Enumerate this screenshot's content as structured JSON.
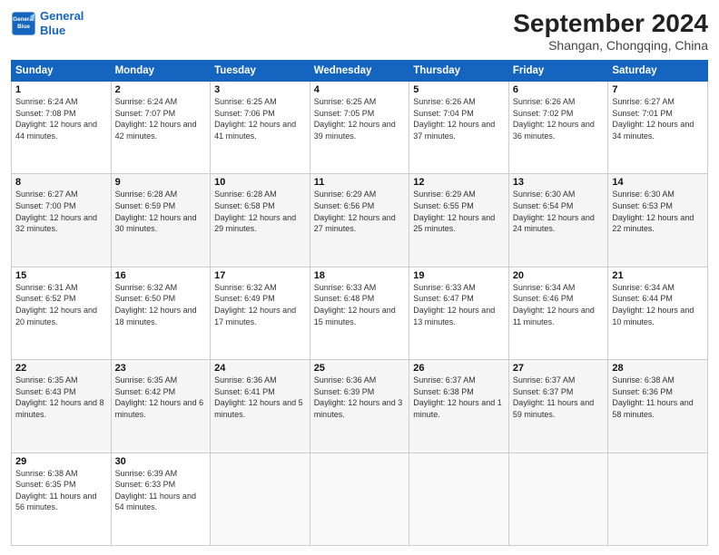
{
  "header": {
    "logo_line1": "General",
    "logo_line2": "Blue",
    "month": "September 2024",
    "location": "Shangan, Chongqing, China"
  },
  "weekdays": [
    "Sunday",
    "Monday",
    "Tuesday",
    "Wednesday",
    "Thursday",
    "Friday",
    "Saturday"
  ],
  "weeks": [
    [
      {
        "day": "1",
        "sunrise": "6:24 AM",
        "sunset": "7:08 PM",
        "daylight": "12 hours and 44 minutes."
      },
      {
        "day": "2",
        "sunrise": "6:24 AM",
        "sunset": "7:07 PM",
        "daylight": "12 hours and 42 minutes."
      },
      {
        "day": "3",
        "sunrise": "6:25 AM",
        "sunset": "7:06 PM",
        "daylight": "12 hours and 41 minutes."
      },
      {
        "day": "4",
        "sunrise": "6:25 AM",
        "sunset": "7:05 PM",
        "daylight": "12 hours and 39 minutes."
      },
      {
        "day": "5",
        "sunrise": "6:26 AM",
        "sunset": "7:04 PM",
        "daylight": "12 hours and 37 minutes."
      },
      {
        "day": "6",
        "sunrise": "6:26 AM",
        "sunset": "7:02 PM",
        "daylight": "12 hours and 36 minutes."
      },
      {
        "day": "7",
        "sunrise": "6:27 AM",
        "sunset": "7:01 PM",
        "daylight": "12 hours and 34 minutes."
      }
    ],
    [
      {
        "day": "8",
        "sunrise": "6:27 AM",
        "sunset": "7:00 PM",
        "daylight": "12 hours and 32 minutes."
      },
      {
        "day": "9",
        "sunrise": "6:28 AM",
        "sunset": "6:59 PM",
        "daylight": "12 hours and 30 minutes."
      },
      {
        "day": "10",
        "sunrise": "6:28 AM",
        "sunset": "6:58 PM",
        "daylight": "12 hours and 29 minutes."
      },
      {
        "day": "11",
        "sunrise": "6:29 AM",
        "sunset": "6:56 PM",
        "daylight": "12 hours and 27 minutes."
      },
      {
        "day": "12",
        "sunrise": "6:29 AM",
        "sunset": "6:55 PM",
        "daylight": "12 hours and 25 minutes."
      },
      {
        "day": "13",
        "sunrise": "6:30 AM",
        "sunset": "6:54 PM",
        "daylight": "12 hours and 24 minutes."
      },
      {
        "day": "14",
        "sunrise": "6:30 AM",
        "sunset": "6:53 PM",
        "daylight": "12 hours and 22 minutes."
      }
    ],
    [
      {
        "day": "15",
        "sunrise": "6:31 AM",
        "sunset": "6:52 PM",
        "daylight": "12 hours and 20 minutes."
      },
      {
        "day": "16",
        "sunrise": "6:32 AM",
        "sunset": "6:50 PM",
        "daylight": "12 hours and 18 minutes."
      },
      {
        "day": "17",
        "sunrise": "6:32 AM",
        "sunset": "6:49 PM",
        "daylight": "12 hours and 17 minutes."
      },
      {
        "day": "18",
        "sunrise": "6:33 AM",
        "sunset": "6:48 PM",
        "daylight": "12 hours and 15 minutes."
      },
      {
        "day": "19",
        "sunrise": "6:33 AM",
        "sunset": "6:47 PM",
        "daylight": "12 hours and 13 minutes."
      },
      {
        "day": "20",
        "sunrise": "6:34 AM",
        "sunset": "6:46 PM",
        "daylight": "12 hours and 11 minutes."
      },
      {
        "day": "21",
        "sunrise": "6:34 AM",
        "sunset": "6:44 PM",
        "daylight": "12 hours and 10 minutes."
      }
    ],
    [
      {
        "day": "22",
        "sunrise": "6:35 AM",
        "sunset": "6:43 PM",
        "daylight": "12 hours and 8 minutes."
      },
      {
        "day": "23",
        "sunrise": "6:35 AM",
        "sunset": "6:42 PM",
        "daylight": "12 hours and 6 minutes."
      },
      {
        "day": "24",
        "sunrise": "6:36 AM",
        "sunset": "6:41 PM",
        "daylight": "12 hours and 5 minutes."
      },
      {
        "day": "25",
        "sunrise": "6:36 AM",
        "sunset": "6:39 PM",
        "daylight": "12 hours and 3 minutes."
      },
      {
        "day": "26",
        "sunrise": "6:37 AM",
        "sunset": "6:38 PM",
        "daylight": "12 hours and 1 minute."
      },
      {
        "day": "27",
        "sunrise": "6:37 AM",
        "sunset": "6:37 PM",
        "daylight": "11 hours and 59 minutes."
      },
      {
        "day": "28",
        "sunrise": "6:38 AM",
        "sunset": "6:36 PM",
        "daylight": "11 hours and 58 minutes."
      }
    ],
    [
      {
        "day": "29",
        "sunrise": "6:38 AM",
        "sunset": "6:35 PM",
        "daylight": "11 hours and 56 minutes."
      },
      {
        "day": "30",
        "sunrise": "6:39 AM",
        "sunset": "6:33 PM",
        "daylight": "11 hours and 54 minutes."
      },
      null,
      null,
      null,
      null,
      null
    ]
  ],
  "labels": {
    "sunrise": "Sunrise:",
    "sunset": "Sunset:",
    "daylight": "Daylight:"
  }
}
